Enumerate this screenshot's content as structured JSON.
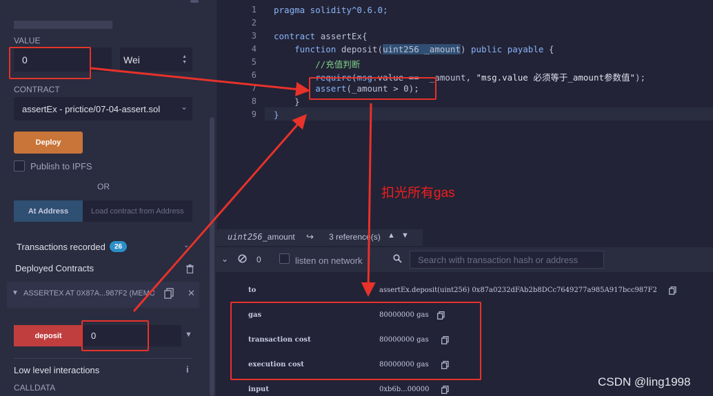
{
  "left_panel": {
    "value_label": "VALUE",
    "value_input": "0",
    "unit_select": "Wei",
    "contract_label": "CONTRACT",
    "contract_select": "assertEx - prictice/07-04-assert.sol",
    "deploy_button": "Deploy",
    "publish_label": "Publish to IPFS",
    "or_label": "OR",
    "at_address_button": "At Address",
    "at_address_placeholder": "Load contract from Address",
    "transactions_label": "Transactions recorded",
    "transactions_count": "26",
    "deployed_label": "Deployed Contracts",
    "instance_name": "ASSERTEX AT 0X87A...987F2 (MEMORY)",
    "deposit_button": "deposit",
    "deposit_input": "0",
    "low_level_label": "Low level interactions",
    "calldata_label": "CALLDATA"
  },
  "editor": {
    "line_numbers": [
      "1",
      "2",
      "3",
      "4",
      "5",
      "6",
      "7",
      "8",
      "9"
    ],
    "lines": [
      {
        "segments": [
          {
            "t": "pragma solidity^0.6.0;",
            "c": "kw"
          }
        ]
      },
      {
        "segments": []
      },
      {
        "segments": [
          {
            "t": "contract",
            "c": "kw"
          },
          {
            "t": " assertEx{",
            "c": ""
          }
        ]
      },
      {
        "segments": [
          {
            "t": "    ",
            "c": ""
          },
          {
            "t": "function",
            "c": "kw"
          },
          {
            "t": " deposit(",
            "c": ""
          },
          {
            "t": "uint256 _amount",
            "c": "hl"
          },
          {
            "t": ") ",
            "c": ""
          },
          {
            "t": "public payable",
            "c": "kw"
          },
          {
            "t": " {",
            "c": ""
          }
        ]
      },
      {
        "segments": [
          {
            "t": "        //充值判断",
            "c": "cm"
          }
        ]
      },
      {
        "segments": [
          {
            "t": "        ",
            "c": ""
          },
          {
            "t": "require",
            "c": "kw"
          },
          {
            "t": "(",
            "c": ""
          },
          {
            "t": "msg",
            "c": "kw"
          },
          {
            "t": ".value ==  _amount, ",
            "c": ""
          },
          {
            "t": "\"msg.value 必须等于_amount参数值\"",
            "c": "str"
          },
          {
            "t": ");",
            "c": ""
          }
        ]
      },
      {
        "segments": [
          {
            "t": "        ",
            "c": ""
          },
          {
            "t": "assert",
            "c": "kw"
          },
          {
            "t": "(_amount > 0);",
            "c": ""
          }
        ]
      },
      {
        "segments": [
          {
            "t": "    }",
            "c": ""
          }
        ]
      },
      {
        "segments": [
          {
            "t": "}",
            "c": "kw"
          }
        ]
      }
    ]
  },
  "references": {
    "type": "uint256",
    "name": "_amount",
    "count": "3 reference(s)"
  },
  "terminal": {
    "counter": "0",
    "listen_label": "listen on network",
    "search_placeholder": "Search with transaction hash or address",
    "rows": [
      {
        "key": "to",
        "value": "assertEx.deposit(uint256) 0x87a0232dFAb2b8DCc7649277a985A917bcc987F2"
      },
      {
        "key": "gas",
        "value": "80000000 gas"
      },
      {
        "key": "transaction cost",
        "value": "80000000 gas"
      },
      {
        "key": "execution cost",
        "value": "80000000 gas"
      },
      {
        "key": "input",
        "value": "0xb6b...00000"
      }
    ]
  },
  "annotation": {
    "text": "扣光所有gas",
    "color": "#f01e1e"
  },
  "watermark": "CSDN @ling1998"
}
